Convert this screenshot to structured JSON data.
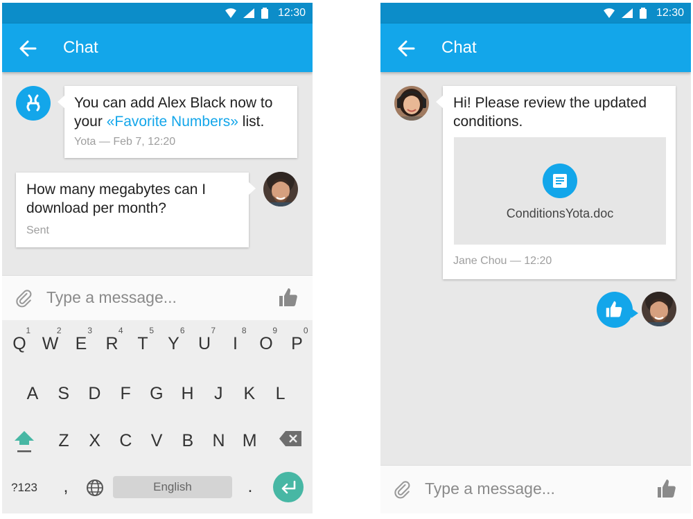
{
  "status": {
    "time": "12:30"
  },
  "screens": [
    {
      "title": "Chat",
      "messages": [
        {
          "from": "Yota",
          "text_before": "You can add Alex Black now to your ",
          "link": "«Favorite Numbers»",
          "text_after": " list.",
          "meta": "Yota — Feb 7, 12:20",
          "avatar_icon": "yota-logo-icon"
        },
        {
          "from": "me",
          "text": "How many megabytes can I download per month?",
          "meta": "Sent",
          "avatar_icon": "user-avatar"
        }
      ],
      "input": {
        "placeholder": "Type a message..."
      },
      "keyboard": {
        "row1": [
          {
            "k": "Q",
            "n": "1"
          },
          {
            "k": "W",
            "n": "2"
          },
          {
            "k": "E",
            "n": "3"
          },
          {
            "k": "R",
            "n": "4"
          },
          {
            "k": "T",
            "n": "5"
          },
          {
            "k": "Y",
            "n": "6"
          },
          {
            "k": "U",
            "n": "7"
          },
          {
            "k": "I",
            "n": "8"
          },
          {
            "k": "O",
            "n": "9"
          },
          {
            "k": "P",
            "n": "0"
          }
        ],
        "row2": [
          "A",
          "S",
          "D",
          "F",
          "G",
          "H",
          "J",
          "K",
          "L"
        ],
        "row3": [
          "Z",
          "X",
          "C",
          "V",
          "B",
          "N",
          "M"
        ],
        "numbers_key": "?123",
        "comma_key": ",",
        "space_label": "English",
        "period_key": "."
      }
    },
    {
      "title": "Chat",
      "messages": [
        {
          "from": "Jane Chou",
          "text": "Hi! Please review the updated conditions.",
          "attachment": "ConditionsYota.doc",
          "meta": "Jane Chou — 12:20",
          "avatar_icon": "user-avatar"
        },
        {
          "from": "me",
          "sticker": "thumbs-up-icon"
        }
      ],
      "input": {
        "placeholder": "Type a message..."
      }
    }
  ],
  "colors": {
    "status_bar": "#0c8dc9",
    "app_bar": "#13a6ea",
    "background": "#e8e8e8",
    "link": "#13a6ea",
    "enter_key": "#47b7a4",
    "shift_key": "#47b7a4"
  }
}
